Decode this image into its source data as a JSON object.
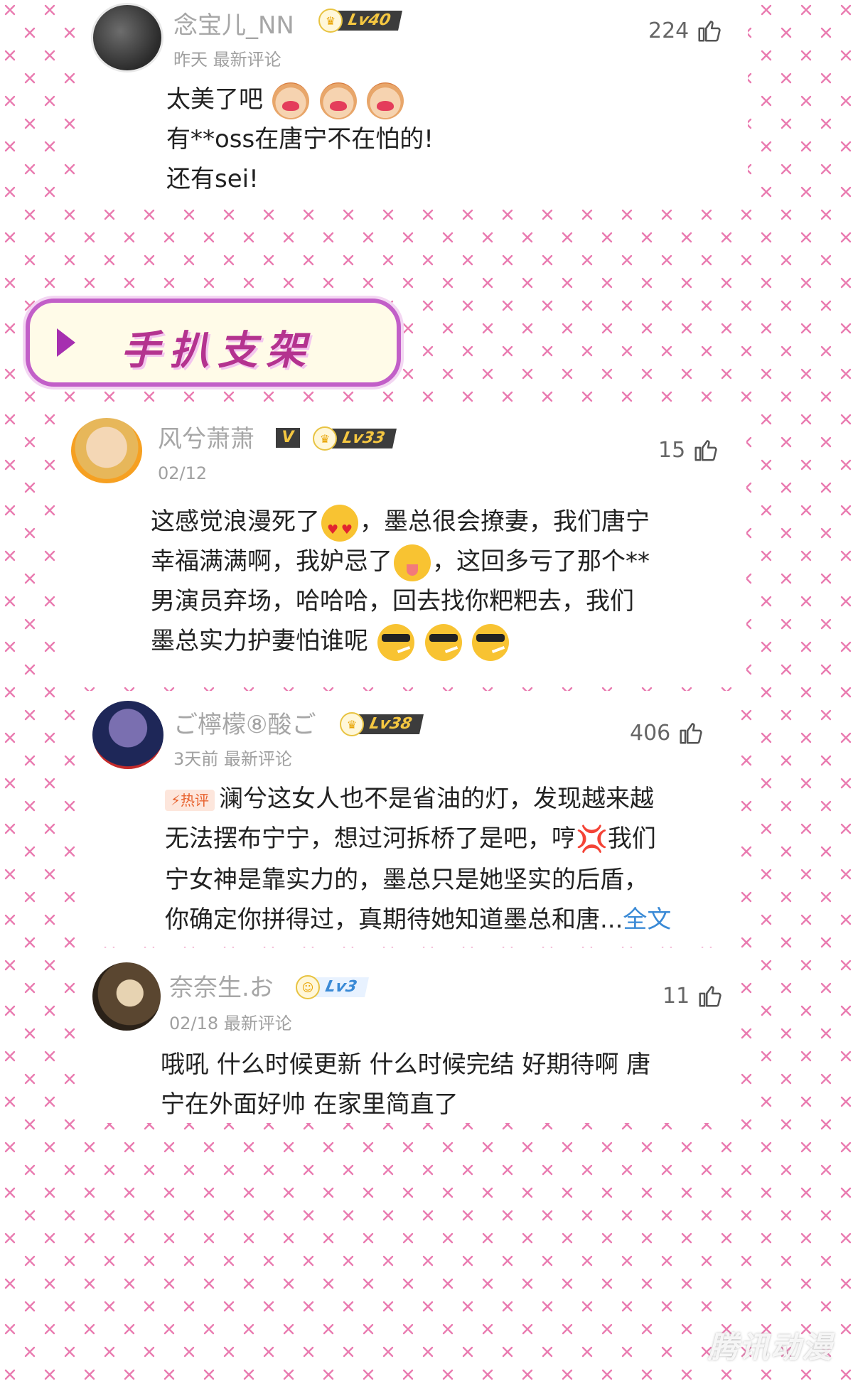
{
  "section_banner": {
    "title": "手扒支架"
  },
  "comments": [
    {
      "username": "念宝儿_NN",
      "level": "Lv40",
      "meta": "昨天 最新评论",
      "likes": "224",
      "lines": [
        "太美了吧",
        "有**oss在唐宁不在怕的!",
        "还有sei!"
      ]
    },
    {
      "username": "风兮萧萧",
      "verified": "V",
      "level": "Lv33",
      "meta": "02/12",
      "likes": "15",
      "lines": [
        "这感觉浪漫死了",
        "，墨总很会撩妻，我们唐宁",
        "幸福满满啊，我妒忌了",
        "，这回多亏了那个**",
        "男演员弃场，哈哈哈，回去找你粑粑去，我们",
        "墨总实力护妻怕谁呢"
      ]
    },
    {
      "username": "ご檸檬⑧酸ご",
      "level": "Lv38",
      "meta": "3天前 最新评论",
      "likes": "406",
      "hot_tag": "热评",
      "lines": [
        "澜兮这女人也不是省油的灯，发现越来越",
        "无法摆布宁宁，想过河拆桥了是吧，哼",
        "我们",
        "宁女神是靠实力的，墨总只是她坚实的后盾，",
        "你确定你拼得过，真期待她知道墨总和唐..."
      ],
      "full_text_link": "全文"
    },
    {
      "username": "奈奈生.お",
      "level": "Lv3",
      "meta": "02/18 最新评论",
      "likes": "11",
      "lines": [
        "哦吼 什么时候更新 什么时候完结 好期待啊 唐",
        "宁在外面好帅 在家里简直了"
      ]
    }
  ],
  "watermark": "腾讯动漫",
  "icons": {
    "like": "thumbs-up-icon",
    "level_crown": "crown-icon"
  },
  "colors": {
    "pattern_pink": "#ec78aa",
    "banner_border": "#c25fc8",
    "banner_text": "#b4338f",
    "link_blue": "#3a8ad6"
  }
}
